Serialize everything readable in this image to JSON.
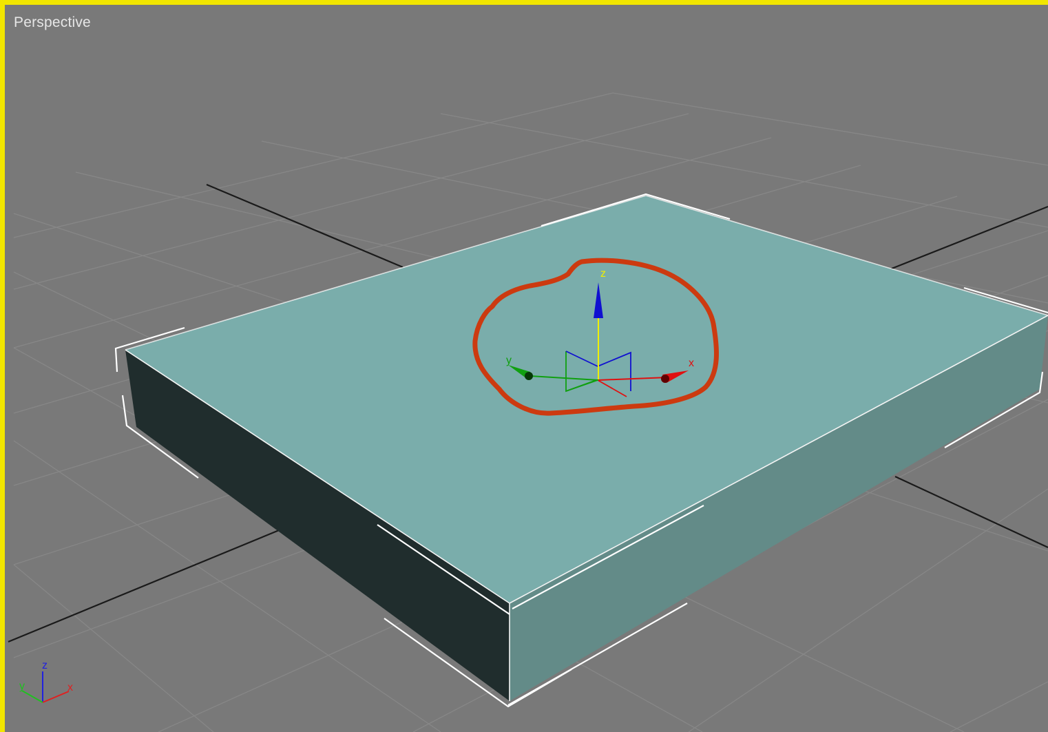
{
  "viewport": {
    "label": "Perspective",
    "active_border_color": "#f2e600",
    "background_color": "#797979"
  },
  "object": {
    "type": "box",
    "top_color": "#7aadab",
    "front_left_color": "#202d2d",
    "front_right_color": "#638b88",
    "selection_brackets_color": "#ffffff"
  },
  "transform_gizmo": {
    "mode": "move",
    "x_label": "x",
    "y_label": "y",
    "z_label": "z",
    "x_color": "#e01010",
    "y_color": "#10a010",
    "z_color": "#1010d0",
    "highlight_color": "#f0f000"
  },
  "annotation": {
    "shape": "hand-drawn-circle",
    "color": "#cc3a10"
  },
  "view_axis_tripod": {
    "x_label": "x",
    "y_label": "y",
    "z_label": "z"
  }
}
